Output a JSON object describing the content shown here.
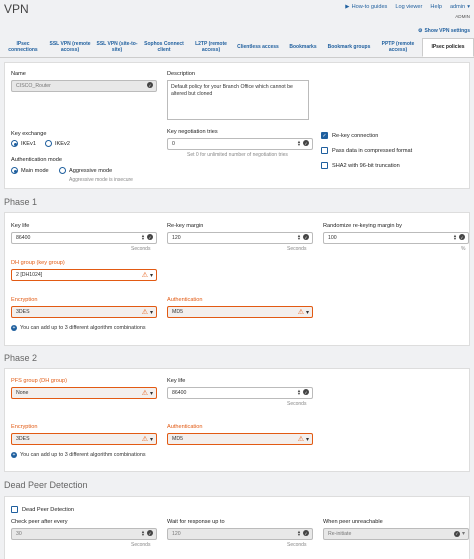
{
  "header": {
    "title": "VPN",
    "how_to": "How-to guides",
    "log_viewer": "Log viewer",
    "help": "Help",
    "admin": "admin",
    "admin_sub": "ADMIN",
    "show_settings": "Show VPN settings"
  },
  "tabs": [
    {
      "label": "IPsec connections"
    },
    {
      "label": "SSL VPN (remote access)"
    },
    {
      "label": "SSL VPN (site-to-site)"
    },
    {
      "label": "Sophos Connect client"
    },
    {
      "label": "L2TP (remote access)"
    },
    {
      "label": "Clientless access"
    },
    {
      "label": "Bookmarks"
    },
    {
      "label": "Bookmark groups"
    },
    {
      "label": "PPTP (remote access)"
    },
    {
      "label": "IPsec policies"
    }
  ],
  "general": {
    "name_label": "Name",
    "name_value": "CISCO_Router",
    "description_label": "Description",
    "description_value": "Default policy for your Branch Office which cannot be altered but cloned",
    "key_exchange_label": "Key exchange",
    "ikev1": "IKEv1",
    "ikev2": "IKEv2",
    "key_negotiation_label": "Key negotiation tries",
    "key_negotiation_value": "0",
    "key_negotiation_hint": "Set 0 for unlimited number of negotiation tries",
    "rekey_label": "Re-key connection",
    "pass_data_label": "Pass data in compressed format",
    "sha2_label": "SHA2 with 96-bit truncation",
    "auth_mode_label": "Authentication mode",
    "main_mode": "Main mode",
    "aggressive_mode": "Aggressive mode",
    "aggressive_hint": "Aggressive mode is insecure"
  },
  "phase1": {
    "title": "Phase 1",
    "key_life_label": "Key life",
    "key_life_value": "86400",
    "key_life_unit": "Seconds",
    "rekey_margin_label": "Re-key margin",
    "rekey_margin_value": "120",
    "rekey_margin_unit": "Seconds",
    "randomize_label": "Randomize re-keying margin by",
    "randomize_value": "100",
    "randomize_unit": "%",
    "dh_label": "DH group (key group)",
    "dh_value": "2 [DH1024]",
    "encryption_label": "Encryption",
    "encryption_value": "3DES",
    "authentication_label": "Authentication",
    "authentication_value": "MD5",
    "add_note": "You can add up to 3 different algorithm combinations"
  },
  "phase2": {
    "title": "Phase 2",
    "pfs_label": "PFS group (DH group)",
    "pfs_value": "None",
    "key_life_label": "Key life",
    "key_life_value": "86400",
    "key_life_unit": "Seconds",
    "encryption_label": "Encryption",
    "encryption_value": "3DES",
    "authentication_label": "Authentication",
    "authentication_value": "MD5",
    "add_note": "You can add up to 3 different algorithm combinations"
  },
  "dpd": {
    "title": "Dead Peer Detection",
    "enable_label": "Dead Peer Detection",
    "check_label": "Check peer after every",
    "check_value": "30",
    "check_unit": "Seconds",
    "wait_label": "Wait for response up to",
    "wait_value": "120",
    "wait_unit": "Seconds",
    "unreachable_label": "When peer unreachable",
    "unreachable_value": "Re-initiate"
  }
}
